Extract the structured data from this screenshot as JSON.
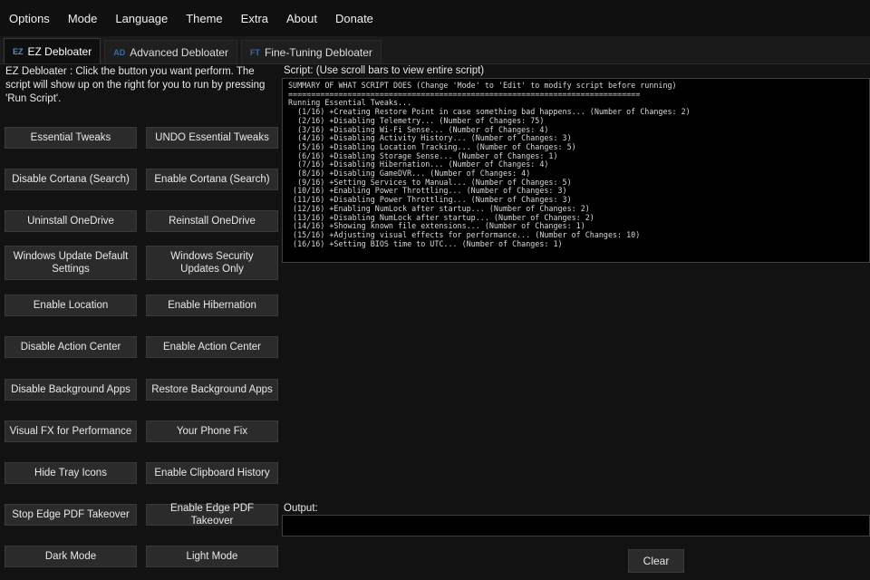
{
  "menu": [
    "Options",
    "Mode",
    "Language",
    "Theme",
    "Extra",
    "About",
    "Donate"
  ],
  "tabs": [
    {
      "badge": "EZ",
      "label": "EZ Debloater"
    },
    {
      "badge": "AD",
      "label": "Advanced Debloater"
    },
    {
      "badge": "FT",
      "label": "Fine-Tuning Debloater"
    }
  ],
  "intro": "EZ Debloater : Click the button you want perform. The script will show up on the right for you to run by pressing 'Run Script'.",
  "buttons": {
    "essential_tweaks": "Essential Tweaks",
    "undo_essential_tweaks": "UNDO Essential Tweaks",
    "disable_cortana": "Disable Cortana (Search)",
    "enable_cortana": "Enable Cortana (Search)",
    "uninstall_onedrive": "Uninstall OneDrive",
    "reinstall_onedrive": "Reinstall OneDrive",
    "windows_update_default": "Windows Update Default Settings",
    "windows_security_updates": "Windows Security Updates Only",
    "enable_location": "Enable Location",
    "enable_hibernation": "Enable Hibernation",
    "disable_action_center": "Disable Action Center",
    "enable_action_center": "Enable Action Center",
    "disable_background_apps": "Disable Background Apps",
    "restore_background_apps": "Restore Background Apps",
    "visual_fx": "Visual FX for Performance",
    "your_phone_fix": "Your Phone Fix",
    "hide_tray_icons": "Hide Tray Icons",
    "enable_clipboard_history": "Enable Clipboard History",
    "stop_edge_pdf": "Stop Edge PDF Takeover",
    "enable_edge_pdf": "Enable Edge PDF Takeover",
    "dark_mode": "Dark Mode",
    "light_mode": "Light Mode"
  },
  "script": {
    "label": "Script: (Use scroll bars to view entire script)",
    "lines": [
      "SUMMARY OF WHAT SCRIPT DOES (Change 'Mode' to 'Edit' to modify script before running)",
      "=============================================================================",
      "Running Essential Tweaks...",
      "  (1/16) +Creating Restore Point in case something bad happens... (Number of Changes: 2)",
      "  (2/16) +Disabling Telemetry... (Number of Changes: 75)",
      "  (3/16) +Disabling Wi-Fi Sense... (Number of Changes: 4)",
      "  (4/16) +Disabling Activity History... (Number of Changes: 3)",
      "  (5/16) +Disabling Location Tracking... (Number of Changes: 5)",
      "  (6/16) +Disabling Storage Sense... (Number of Changes: 1)",
      "  (7/16) +Disabling Hibernation... (Number of Changes: 4)",
      "  (8/16) +Disabling GameDVR... (Number of Changes: 4)",
      "  (9/16) +Setting Services to Manual... (Number of Changes: 5)",
      " (10/16) +Enabling Power Throttling... (Number of Changes: 3)",
      " (11/16) +Disabling Power Throttling... (Number of Changes: 3)",
      " (12/16) +Enabling NumLock after startup... (Number of Changes: 2)",
      " (13/16) +Disabling NumLock after startup... (Number of Changes: 2)",
      " (14/16) +Showing known file extensions... (Number of Changes: 1)",
      " (15/16) +Adjusting visual effects for performance... (Number of Changes: 10)",
      " (16/16) +Setting BIOS time to UTC... (Number of Changes: 1)"
    ]
  },
  "output": {
    "label": "Output:",
    "value": ""
  },
  "clear_label": "Clear"
}
